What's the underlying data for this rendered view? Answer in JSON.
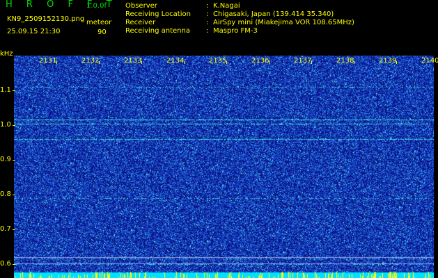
{
  "header": {
    "app_title": "H R O F F T",
    "app_version": "1.0.0f",
    "file_name": "KN9_2509152130.png",
    "mode_label": "meteor",
    "date_time": "25.09.15 21:30",
    "mode_value": "90"
  },
  "observation": [
    {
      "label": "Observer",
      "value": "K.Nagai"
    },
    {
      "label": "Receiving Location",
      "value": "Chigasaki, Japan (139.414 35.340)"
    },
    {
      "label": "Receiver",
      "value": "AirSpy mini (Miakejima VOR 108.65MHz)"
    },
    {
      "label": "Receiving antenna",
      "value": "Maspro FM-3"
    }
  ],
  "colon": ":",
  "axis": {
    "y_unit": "kHz",
    "y_ticks": [
      "1.1",
      "1.0",
      "0.9",
      "0.8",
      "0.7",
      "0.6"
    ],
    "x_ticks": [
      "2131",
      "2132",
      "2133",
      "2134",
      "2135",
      "2136",
      "2137",
      "2138",
      "2139",
      "2140"
    ]
  },
  "colors": {
    "background": "#0a1a8c",
    "noise": "#3060ff",
    "signal": "#40ffd0",
    "text": "#ffff00",
    "title": "#00e000"
  }
}
